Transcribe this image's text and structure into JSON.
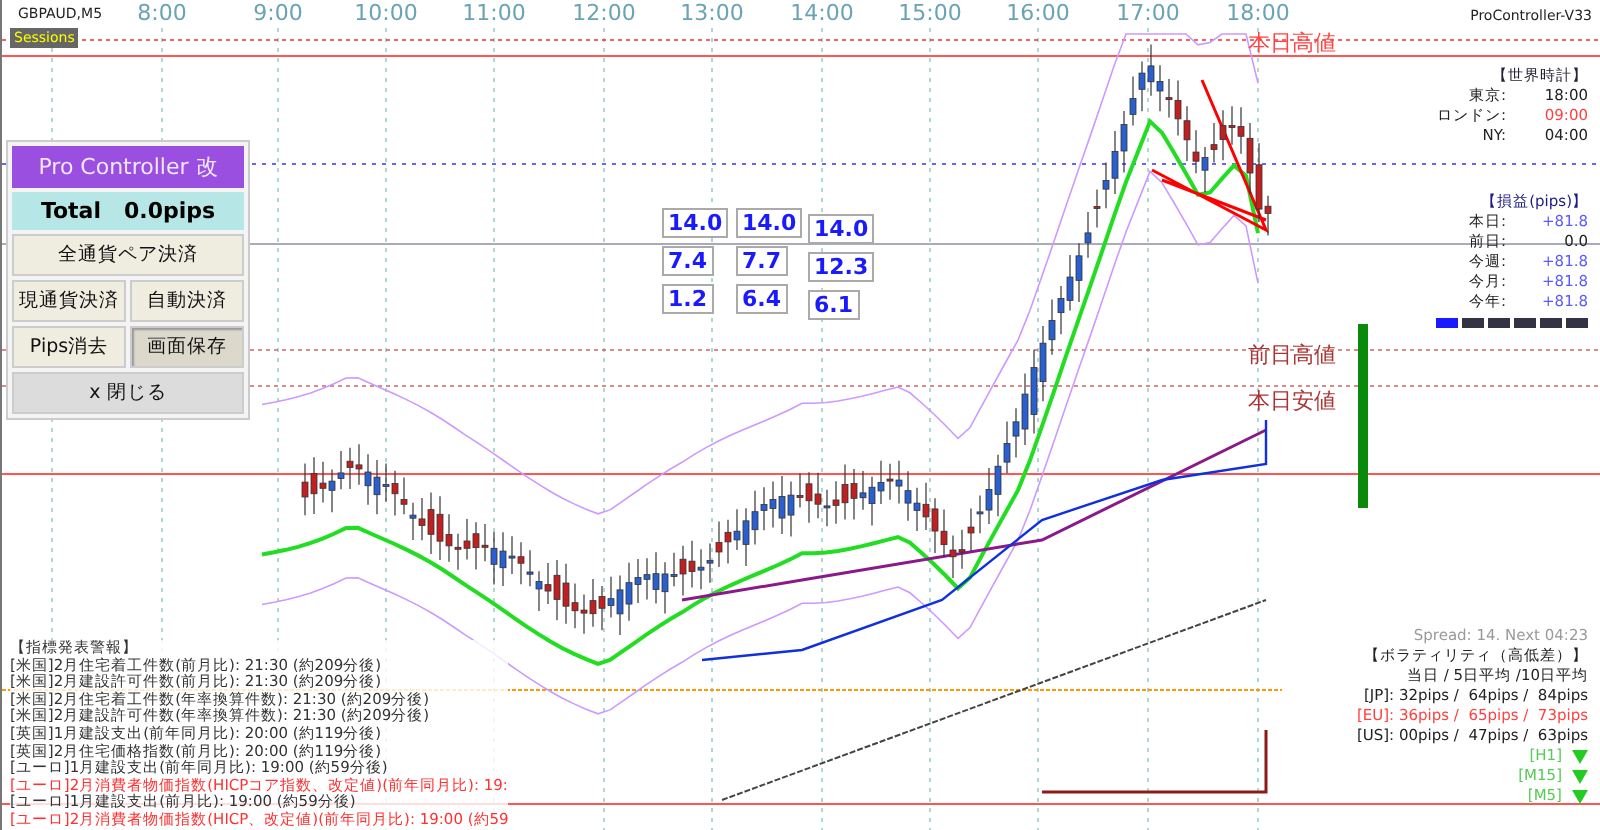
{
  "chart": {
    "symbol": "GBPAUD,M5",
    "sessions_badge": "Sessions",
    "indicator_name": "ProController-V33",
    "time_labels": [
      "8:00",
      "9:00",
      "10:00",
      "11:00",
      "12:00",
      "13:00",
      "14:00",
      "15:00",
      "16:00",
      "17:00",
      "18:00"
    ],
    "price_labels": [
      {
        "text": "本日高値",
        "kind": "high"
      },
      {
        "text": "前日高値",
        "kind": "high"
      },
      {
        "text": "本日安値",
        "kind": "low"
      }
    ]
  },
  "control_panel": {
    "title": "Pro Controller 改",
    "total": "Total   0.0pips",
    "button_rows": [
      [
        {
          "label": "全通貨ペア決済",
          "pressed": false
        }
      ],
      [
        {
          "label": "現通貨決済",
          "pressed": false
        },
        {
          "label": "自動決済",
          "pressed": false
        }
      ],
      [
        {
          "label": "Pips消去",
          "pressed": false
        },
        {
          "label": "画面保存",
          "pressed": true
        }
      ],
      [
        {
          "label": "x 閉じる",
          "pressed": false
        }
      ]
    ]
  },
  "number_boxes": [
    {
      "values": [
        "14.0",
        "7.4",
        "1.2"
      ]
    },
    {
      "values": [
        "14.0",
        "7.7",
        "6.4"
      ]
    },
    {
      "values": [
        "14.0",
        "12.3",
        "6.1"
      ]
    }
  ],
  "world_clock": {
    "title": "【世界時計】",
    "rows": [
      {
        "label": "東京:",
        "time": "18:00",
        "highlight": false
      },
      {
        "label": "ロンドン:",
        "time": "09:00",
        "highlight": true
      },
      {
        "label": "NY:",
        "time": "04:00",
        "highlight": false
      }
    ]
  },
  "pnl": {
    "title": "【損益(pips)】",
    "rows": [
      {
        "label": "本日:",
        "value": "+81.8"
      },
      {
        "label": "前日:",
        "value": "0.0"
      },
      {
        "label": "今週:",
        "value": "+81.8"
      },
      {
        "label": "今月:",
        "value": "+81.8"
      },
      {
        "label": "今年:",
        "value": "+81.8"
      }
    ],
    "period_tabs": [
      {
        "selected": true
      },
      {
        "selected": false
      },
      {
        "selected": false
      },
      {
        "selected": false
      },
      {
        "selected": false
      },
      {
        "selected": false
      }
    ]
  },
  "spread": "Spread: 14. Next 04:23",
  "volatility": {
    "title": "【ボラティリティ（高低差）】",
    "header": "当日 / 5日平均 /10日平均",
    "rows": [
      {
        "label": "[JP]:",
        "values": "32pips /  64pips /  84pips",
        "highlight": false
      },
      {
        "label": "[EU]:",
        "values": "36pips /  65pips /  73pips",
        "highlight": true
      },
      {
        "label": "[US]:",
        "values": "00pips /  47pips /  63pips",
        "highlight": false
      }
    ]
  },
  "timeframes": [
    {
      "label": "[H1]"
    },
    {
      "label": "[M15]"
    },
    {
      "label": "[M5]"
    }
  ],
  "news": {
    "title": "【指標発表警報】",
    "items": [
      {
        "text": "[米国]2月住宅着工件数(前月比): 21:30 (約209分後)",
        "alert": false
      },
      {
        "text": "[米国]2月建設許可件数(前月比): 21:30 (約209分後)",
        "alert": false
      },
      {
        "text": "[米国]2月住宅着工件数(年率換算件数): 21:30 (約209分後)",
        "alert": false
      },
      {
        "text": "[米国]2月建設許可件数(年率換算件数): 21:30 (約209分後)",
        "alert": false
      },
      {
        "text": "[英国]1月建設支出(前年同月比): 20:00 (約119分後)",
        "alert": false
      },
      {
        "text": "[英国]2月住宅価格指数(前月比): 20:00 (約119分後)",
        "alert": false
      },
      {
        "text": "[ユーロ]1月建設支出(前年同月比): 19:00 (約59分後)",
        "alert": false
      },
      {
        "text": "[ユーロ]2月消費者物価指数(HICPコア指数、改定値)(前年同月比): 19:",
        "alert": true
      },
      {
        "text": "[ユーロ]1月建設支出(前月比): 19:00 (約59分後)",
        "alert": false
      },
      {
        "text": "[ユーロ]2月消費者物価指数(HICP、改定値)(前年同月比): 19:00 (約59",
        "alert": true
      }
    ]
  }
}
